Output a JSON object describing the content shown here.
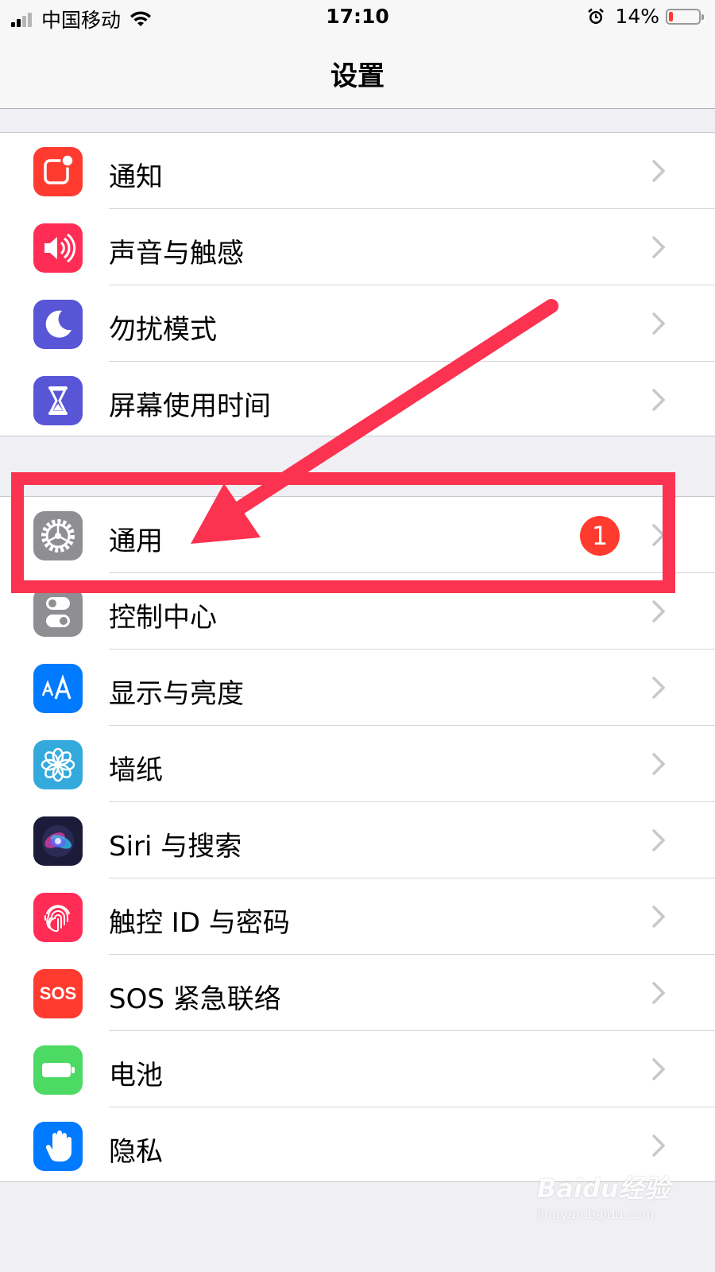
{
  "status_bar": {
    "carrier": "中国移动",
    "time": "17:10",
    "battery_percent_label": "14%",
    "battery_level": 0.14
  },
  "nav": {
    "title": "设置"
  },
  "groups": [
    [
      {
        "label": "通知",
        "icon": "notifications-icon",
        "color": "#ff3b30"
      },
      {
        "label": "声音与触感",
        "icon": "speaker-icon",
        "color": "#ff2d55"
      },
      {
        "label": "勿扰模式",
        "icon": "moon-icon",
        "color": "#5856d6"
      },
      {
        "label": "屏幕使用时间",
        "icon": "hourglass-icon",
        "color": "#5856d6"
      }
    ],
    [
      {
        "label": "通用",
        "icon": "gear-icon",
        "color": "#8e8e93",
        "badge": "1"
      },
      {
        "label": "控制中心",
        "icon": "toggle-icon",
        "color": "#8e8e93"
      },
      {
        "label": "显示与亮度",
        "icon": "text-size-icon",
        "color": "#007aff"
      },
      {
        "label": "墙纸",
        "icon": "flower-icon",
        "color": "#34aadc"
      },
      {
        "label": "Siri 与搜索",
        "icon": "siri-icon",
        "color": "#1c1c3a"
      },
      {
        "label": "触控 ID 与密码",
        "icon": "fingerprint-icon",
        "color": "#ff2d55"
      },
      {
        "label": "SOS 紧急联络",
        "icon": "sos-icon",
        "color": "#ff3b30",
        "icon_text": "SOS"
      },
      {
        "label": "电池",
        "icon": "battery-icon",
        "color": "#4cd964"
      },
      {
        "label": "隐私",
        "icon": "hand-icon",
        "color": "#007aff"
      }
    ]
  ],
  "annotation_color": "#fb3350",
  "watermark": {
    "logo": "Baidu经验",
    "url": "jingyan.baidu.com"
  }
}
